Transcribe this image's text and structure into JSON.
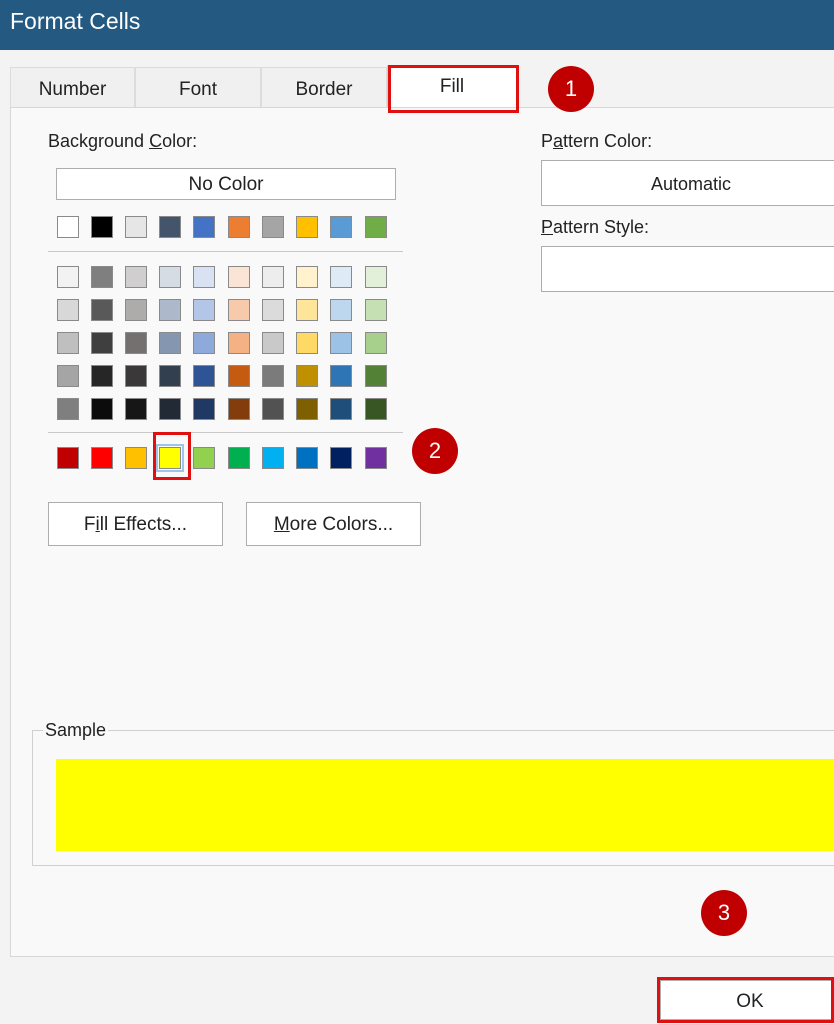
{
  "window": {
    "title": "Format Cells"
  },
  "tabs": [
    {
      "label": "Number"
    },
    {
      "label": "Font"
    },
    {
      "label": "Border"
    },
    {
      "label": "Fill",
      "selected": true
    }
  ],
  "fill": {
    "background_label_pre": "Background ",
    "background_label_key": "C",
    "background_label_post": "olor:",
    "no_color_label": "No Color",
    "pattern_color_label_pre": "P",
    "pattern_color_label_key": "a",
    "pattern_color_label_post": "ttern Color:",
    "pattern_color_value": "Automatic",
    "pattern_style_label_key": "P",
    "pattern_style_label_post": "attern Style:",
    "pattern_style_value": "",
    "fill_effects_pre": "F",
    "fill_effects_key": "i",
    "fill_effects_post": "ll Effects...",
    "more_colors_key": "M",
    "more_colors_post": "ore Colors...",
    "sample_label": "Sample",
    "sample_color": "#ffff00",
    "selected_color": "#ffff00",
    "theme_row": [
      "#ffffff",
      "#000000",
      "#e7e6e6",
      "#44546a",
      "#4472c4",
      "#ed7d31",
      "#a5a5a5",
      "#ffc000",
      "#5b9bd5",
      "#70ad47"
    ],
    "tint_rows": [
      [
        "#f2f2f2",
        "#7f7f7f",
        "#d0cece",
        "#d6dce4",
        "#d9e2f3",
        "#fbe4d5",
        "#ededed",
        "#fff2cc",
        "#deebf6",
        "#e2efd9"
      ],
      [
        "#d8d8d8",
        "#595959",
        "#aeabab",
        "#adb9ca",
        "#b4c6e7",
        "#f7caac",
        "#dbdbdb",
        "#fee599",
        "#bdd7ee",
        "#c5e0b3"
      ],
      [
        "#bfbfbf",
        "#3f3f3f",
        "#757070",
        "#8496b0",
        "#8eaadb",
        "#f4b183",
        "#c9c9c9",
        "#ffd965",
        "#9cc3e5",
        "#a8d08d"
      ],
      [
        "#a5a5a5",
        "#262626",
        "#3a3838",
        "#323f4f",
        "#2f5496",
        "#c55a11",
        "#7b7b7b",
        "#bf9000",
        "#2e75b5",
        "#538135"
      ],
      [
        "#7f7f7f",
        "#0c0c0c",
        "#171616",
        "#222a35",
        "#1f3864",
        "#833c0b",
        "#525252",
        "#7f6000",
        "#1e4e79",
        "#375623"
      ]
    ],
    "standard_row": [
      "#c00000",
      "#ff0000",
      "#ffc000",
      "#ffff00",
      "#92d050",
      "#00b050",
      "#00b0f0",
      "#0070c0",
      "#002060",
      "#7030a0"
    ]
  },
  "footer": {
    "ok_label": "OK"
  },
  "annotations": [
    {
      "number": "1"
    },
    {
      "number": "2"
    },
    {
      "number": "3"
    }
  ]
}
